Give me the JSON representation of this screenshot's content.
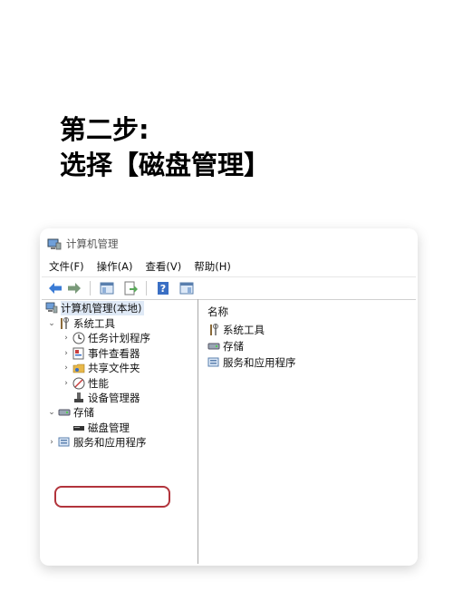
{
  "heading": {
    "line1": "第二步:",
    "line2": "选择【磁盘管理】"
  },
  "window": {
    "title": "计算机管理"
  },
  "menu": [
    "文件(F)",
    "操作(A)",
    "查看(V)",
    "帮助(H)"
  ],
  "tree": {
    "root": "计算机管理(本地)",
    "system_tools": "系统工具",
    "task_scheduler": "任务计划程序",
    "event_viewer": "事件查看器",
    "shared_folders": "共享文件夹",
    "performance": "性能",
    "device_manager": "设备管理器",
    "storage": "存储",
    "disk_management": "磁盘管理",
    "services_apps": "服务和应用程序"
  },
  "right_pane": {
    "header": "名称",
    "items": [
      "系统工具",
      "存储",
      "服务和应用程序"
    ]
  },
  "colors": {
    "highlight": "#b2343c",
    "nav_arrow": "#3a7bd5"
  },
  "icons": [
    "computer-management-icon",
    "back-arrow-icon",
    "forward-arrow-icon",
    "show-hide-tree-icon",
    "export-list-icon",
    "help-icon",
    "properties-icon"
  ]
}
